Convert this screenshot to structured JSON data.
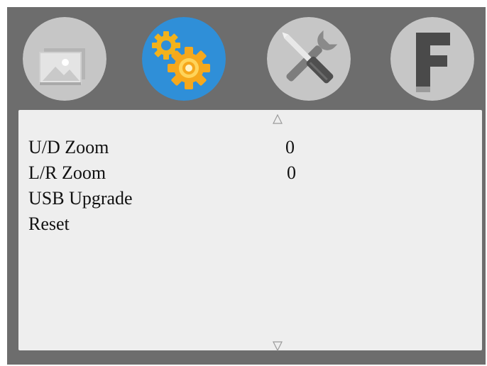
{
  "tabs": [
    {
      "icon": "picture-icon",
      "active": false
    },
    {
      "icon": "gears-icon",
      "active": true
    },
    {
      "icon": "tools-icon",
      "active": false
    },
    {
      "icon": "letter-f-icon",
      "active": false
    }
  ],
  "colors": {
    "background": "#6d6d6d",
    "panel": "#eeeeee",
    "active_tab": "#2f8fd8",
    "inactive_tab": "#c6c6c6",
    "text": "#111111"
  },
  "menu": {
    "items": [
      {
        "label": "U/D Zoom",
        "value": "0"
      },
      {
        "label": "L/R Zoom",
        "value": "0"
      },
      {
        "label": "USB Upgrade",
        "value": ""
      },
      {
        "label": "Reset",
        "value": ""
      }
    ]
  },
  "tab_f_letter": "F"
}
